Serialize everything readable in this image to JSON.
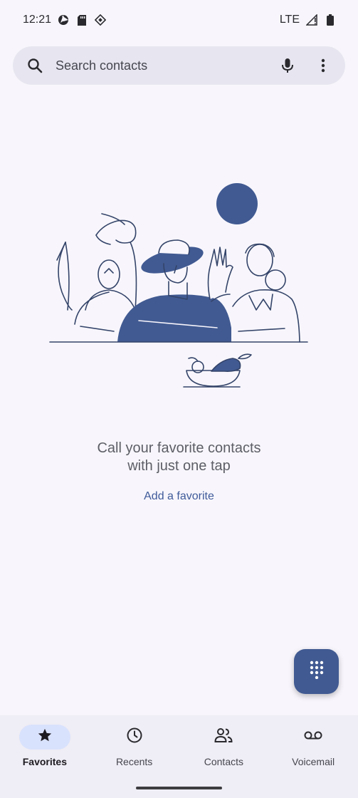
{
  "status_bar": {
    "time": "12:21",
    "network": "LTE",
    "icons": [
      "aperture-icon",
      "sd-card-icon",
      "diamond-icon",
      "signal-icon",
      "battery-icon"
    ]
  },
  "search": {
    "placeholder": "Search contacts",
    "icons": [
      "search-icon",
      "microphone-icon",
      "more-vert-icon"
    ]
  },
  "empty_state": {
    "line1": "Call your favorite contacts",
    "line2": "with just one tap",
    "action": "Add a favorite"
  },
  "fab": {
    "icon": "dialpad-icon"
  },
  "bottom_nav": {
    "items": [
      {
        "label": "Favorites",
        "icon": "star-icon",
        "active": true
      },
      {
        "label": "Recents",
        "icon": "clock-icon",
        "active": false
      },
      {
        "label": "Contacts",
        "icon": "people-icon",
        "active": false
      },
      {
        "label": "Voicemail",
        "icon": "voicemail-icon",
        "active": false
      }
    ]
  },
  "colors": {
    "background": "#f8f6fc",
    "accent": "#415a92",
    "search_bar": "#e7e6f0",
    "nav_bar": "#efedf5",
    "active_pill": "#d9e2fc"
  }
}
